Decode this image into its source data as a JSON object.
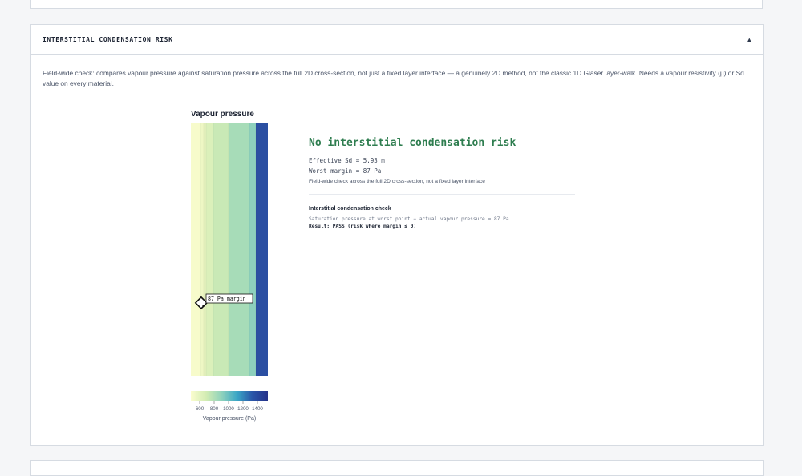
{
  "section": {
    "title": "INTERSTITIAL CONDENSATION RISK",
    "collapse_icon": "▲",
    "description": "Field-wide check: compares vapour pressure against saturation pressure across the full 2D cross-section, not just a fixed layer interface — a genuinely 2D method, not the classic 1D Glaser layer-walk. Needs a vapour resistivity (μ) or Sd value on every material."
  },
  "chart_data": {
    "type": "heatmap",
    "title": "Vapour pressure",
    "marker_label": "87 Pa margin",
    "colorbar": {
      "ticks": [
        "600",
        "800",
        "1000",
        "1200",
        "1400"
      ],
      "label": "Vapour pressure (Pa)",
      "colors": [
        "#fbfdcf",
        "#d2ecb3",
        "#8fd2bc",
        "#3aa6c6",
        "#2a55a8",
        "#26328a"
      ]
    },
    "bands": [
      {
        "value": 620,
        "color": "#f7fbcb"
      },
      {
        "value": 650,
        "color": "#eef7c4"
      },
      {
        "value": 700,
        "color": "#e6f4bf"
      },
      {
        "value": 760,
        "color": "#dbf0ba"
      },
      {
        "value": 850,
        "color": "#c9e9b6"
      },
      {
        "value": 1000,
        "color": "#a7dcb8"
      },
      {
        "value": 1100,
        "color": "#8dd0bd"
      },
      {
        "value": 1300,
        "color": "#2b4fa2"
      },
      {
        "value": 1450,
        "color": "#253185"
      }
    ]
  },
  "result": {
    "headline": "No interstitial condensation risk",
    "effective_sd": "Effective Sd = 5.93 m",
    "worst_margin": "Worst margin = 87 Pa",
    "note": "Field-wide check across the full 2D cross-section, not a fixed layer interface",
    "check_heading": "Interstitial condensation check",
    "check_line": "Saturation pressure at worst point − actual vapour pressure = 87 Pa",
    "check_result": "Result: PASS (risk where margin ≤ 0)"
  }
}
